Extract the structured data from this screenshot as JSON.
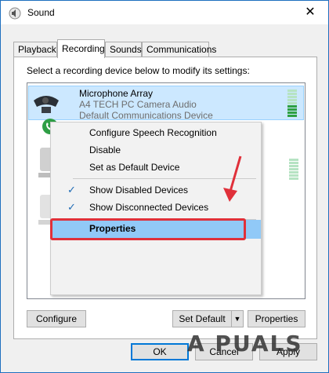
{
  "window": {
    "title": "Sound",
    "close_glyph": "✕"
  },
  "tabs": [
    {
      "label": "Playback",
      "active": false
    },
    {
      "label": "Recording",
      "active": true
    },
    {
      "label": "Sounds",
      "active": false
    },
    {
      "label": "Communications",
      "active": false
    }
  ],
  "instruction": "Select a recording device below to modify its settings:",
  "device": {
    "name": "Microphone Array",
    "driver": "A4 TECH PC Camera Audio",
    "status": "Default Communications Device"
  },
  "context_menu": {
    "items": [
      {
        "label": "Configure Speech Recognition",
        "checked": false
      },
      {
        "label": "Disable",
        "checked": false
      },
      {
        "label": "Set as Default Device",
        "checked": false
      },
      {
        "label": "Show Disabled Devices",
        "checked": true
      },
      {
        "label": "Show Disconnected Devices",
        "checked": true
      },
      {
        "label": "Properties",
        "checked": false,
        "highlighted": true
      }
    ],
    "check_glyph": "✓"
  },
  "buttons": {
    "configure": "Configure",
    "set_default": "Set Default",
    "properties": "Properties",
    "ok": "OK",
    "cancel": "Cancel",
    "apply": "Apply"
  },
  "watermark": "A PUALS",
  "colors": {
    "accent": "#0078d7",
    "selection": "#cce8ff",
    "menu_highlight": "#91c9f7",
    "annotation_red": "#e0303a",
    "meter_green": "#2ea043"
  }
}
